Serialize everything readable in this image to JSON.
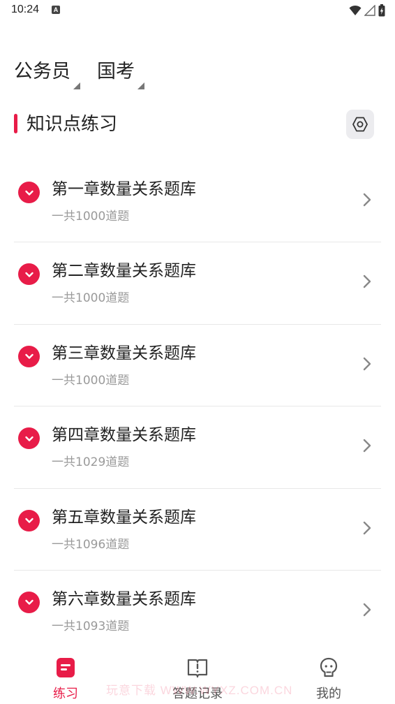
{
  "status_bar": {
    "time": "10:24",
    "notification_badge": "A"
  },
  "exam_selector": [
    {
      "label": "公务员"
    },
    {
      "label": "国考"
    }
  ],
  "section": {
    "title": "知识点练习"
  },
  "chapters": [
    {
      "title": "第一章数量关系题库",
      "count": "一共1000道题"
    },
    {
      "title": "第二章数量关系题库",
      "count": "一共1000道题"
    },
    {
      "title": "第三章数量关系题库",
      "count": "一共1000道题"
    },
    {
      "title": "第四章数量关系题库",
      "count": "一共1029道题"
    },
    {
      "title": "第五章数量关系题库",
      "count": "一共1096道题"
    },
    {
      "title": "第六章数量关系题库",
      "count": "一共1093道题"
    }
  ],
  "bottom_nav": [
    {
      "label": "练习",
      "icon": "practice-icon",
      "active": true
    },
    {
      "label": "答题记录",
      "icon": "records-icon",
      "active": false
    },
    {
      "label": "我的",
      "icon": "profile-icon",
      "active": false
    }
  ],
  "watermark": "玩意下载 WWW.WYXZ.COM.CN",
  "colors": {
    "accent": "#e81c48",
    "text": "#222222",
    "subtext": "#9a9a9a",
    "divider": "#e8e8e8"
  }
}
